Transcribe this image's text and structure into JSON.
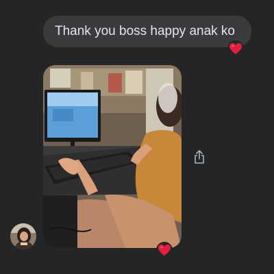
{
  "message": {
    "text": "Thank you boss happy anak ko",
    "reaction": "heart-icon"
  },
  "photo_message": {
    "alt": "photo-attachment",
    "reaction": "heart-icon"
  },
  "actions": {
    "share_icon": "share-icon"
  },
  "sender": {
    "avatar": "avatar"
  },
  "colors": {
    "background": "#242526",
    "bubble": "#3a3b3c",
    "text": "#e4e6eb",
    "heart": "#e41e3f",
    "icon": "#b0b3b8"
  }
}
